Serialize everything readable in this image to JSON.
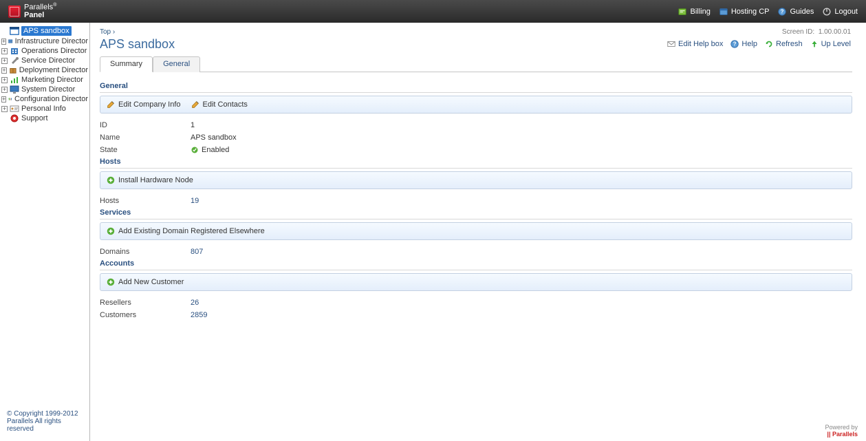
{
  "header": {
    "brand_line1": "Parallels",
    "brand_line2": "Panel",
    "links": {
      "billing": "Billing",
      "hosting_cp": "Hosting CP",
      "guides": "Guides",
      "logout": "Logout"
    }
  },
  "sidebar": {
    "items": [
      {
        "label": "APS sandbox",
        "icon": "window",
        "expandable": false,
        "selected": true
      },
      {
        "label": "Infrastructure Director",
        "icon": "infra",
        "expandable": true
      },
      {
        "label": "Operations Director",
        "icon": "ops",
        "expandable": true
      },
      {
        "label": "Service Director",
        "icon": "service",
        "expandable": true
      },
      {
        "label": "Deployment Director",
        "icon": "deploy",
        "expandable": true
      },
      {
        "label": "Marketing Director",
        "icon": "marketing",
        "expandable": true
      },
      {
        "label": "System Director",
        "icon": "system",
        "expandable": true
      },
      {
        "label": "Configuration Director",
        "icon": "config",
        "expandable": true
      },
      {
        "label": "Personal Info",
        "icon": "personal",
        "expandable": true
      },
      {
        "label": "Support",
        "icon": "support",
        "expandable": false
      }
    ],
    "footer": {
      "copyright": "© Copyright 1999-2012",
      "rights": "Parallels All rights reserved"
    }
  },
  "content": {
    "breadcrumb_top": "Top",
    "breadcrumb_sep": "›",
    "screen_id_label": "Screen ID:",
    "screen_id": "1.00.00.01",
    "title": "APS sandbox",
    "actions": {
      "edit_help_box": "Edit Help box",
      "help": "Help",
      "refresh": "Refresh",
      "up_level": "Up Level"
    },
    "tabs": [
      {
        "label": "Summary",
        "active": true
      },
      {
        "label": "General",
        "active": false
      }
    ],
    "sections": {
      "general": {
        "title": "General",
        "toolbar": {
          "edit_company_info": "Edit Company Info",
          "edit_contacts": "Edit Contacts"
        },
        "rows": {
          "id_label": "ID",
          "id_value": "1",
          "name_label": "Name",
          "name_value": "APS sandbox",
          "state_label": "State",
          "state_value": "Enabled"
        }
      },
      "hosts": {
        "title": "Hosts",
        "toolbar": {
          "install_node": "Install Hardware Node"
        },
        "rows": {
          "hosts_label": "Hosts",
          "hosts_value": "19"
        }
      },
      "services": {
        "title": "Services",
        "toolbar": {
          "add_domain": "Add Existing Domain Registered Elsewhere"
        },
        "rows": {
          "domains_label": "Domains",
          "domains_value": "807"
        }
      },
      "accounts": {
        "title": "Accounts",
        "toolbar": {
          "add_customer": "Add New Customer"
        },
        "rows": {
          "resellers_label": "Resellers",
          "resellers_value": "26",
          "customers_label": "Customers",
          "customers_value": "2859"
        }
      }
    }
  },
  "footer": {
    "powered_by": "Powered by",
    "parallels": "|| Parallels"
  }
}
